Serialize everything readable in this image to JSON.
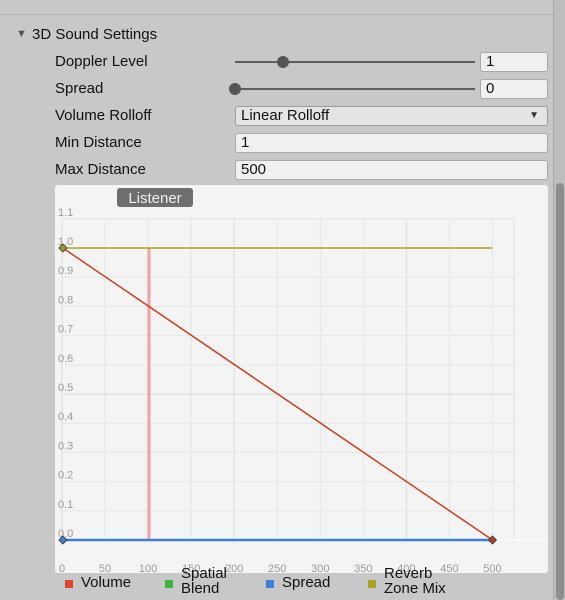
{
  "section": {
    "title": "3D Sound Settings",
    "foldout_icon": "triangle-down-icon"
  },
  "fields": {
    "doppler_level": {
      "label": "Doppler Level",
      "value": "1",
      "slider_fraction": 0.2
    },
    "spread": {
      "label": "Spread",
      "value": "0",
      "slider_fraction": 0.0
    },
    "volume_rolloff": {
      "label": "Volume Rolloff",
      "value": "Linear Rolloff"
    },
    "min_distance": {
      "label": "Min Distance",
      "value": "1"
    },
    "max_distance": {
      "label": "Max Distance",
      "value": "500"
    }
  },
  "curve_editor": {
    "listener_label": "Listener",
    "x_ticks": [
      "0",
      "50",
      "100",
      "150",
      "200",
      "250",
      "300",
      "350",
      "400",
      "450",
      "500"
    ],
    "y_ticks": [
      "0.0",
      "0.1",
      "0.2",
      "0.3",
      "0.4",
      "0.5",
      "0.6",
      "0.7",
      "0.8",
      "0.9",
      "1.0",
      "1.1"
    ],
    "x_max": 525,
    "listener_distance": 101,
    "curves": {
      "volume": {
        "points": [
          [
            1,
            1.0
          ],
          [
            500,
            0.0
          ]
        ],
        "color": "#c84022"
      },
      "reverb_zone_mix": {
        "points": [
          [
            1,
            1.0
          ],
          [
            500,
            1.0
          ]
        ],
        "color": "#a8a222"
      },
      "spread": {
        "points": [
          [
            1,
            0.0
          ],
          [
            500,
            0.0
          ]
        ],
        "color": "#3d7fd4"
      }
    },
    "listener_color": "#f4a0a0"
  },
  "legend": [
    {
      "label": "Volume",
      "color": "#d8432a"
    },
    {
      "label": "Spatial Blend",
      "color": "#3fb33f"
    },
    {
      "label": "Spread",
      "color": "#3d7fd4"
    },
    {
      "label": "Reverb Zone Mix",
      "color": "#a8a222"
    }
  ]
}
